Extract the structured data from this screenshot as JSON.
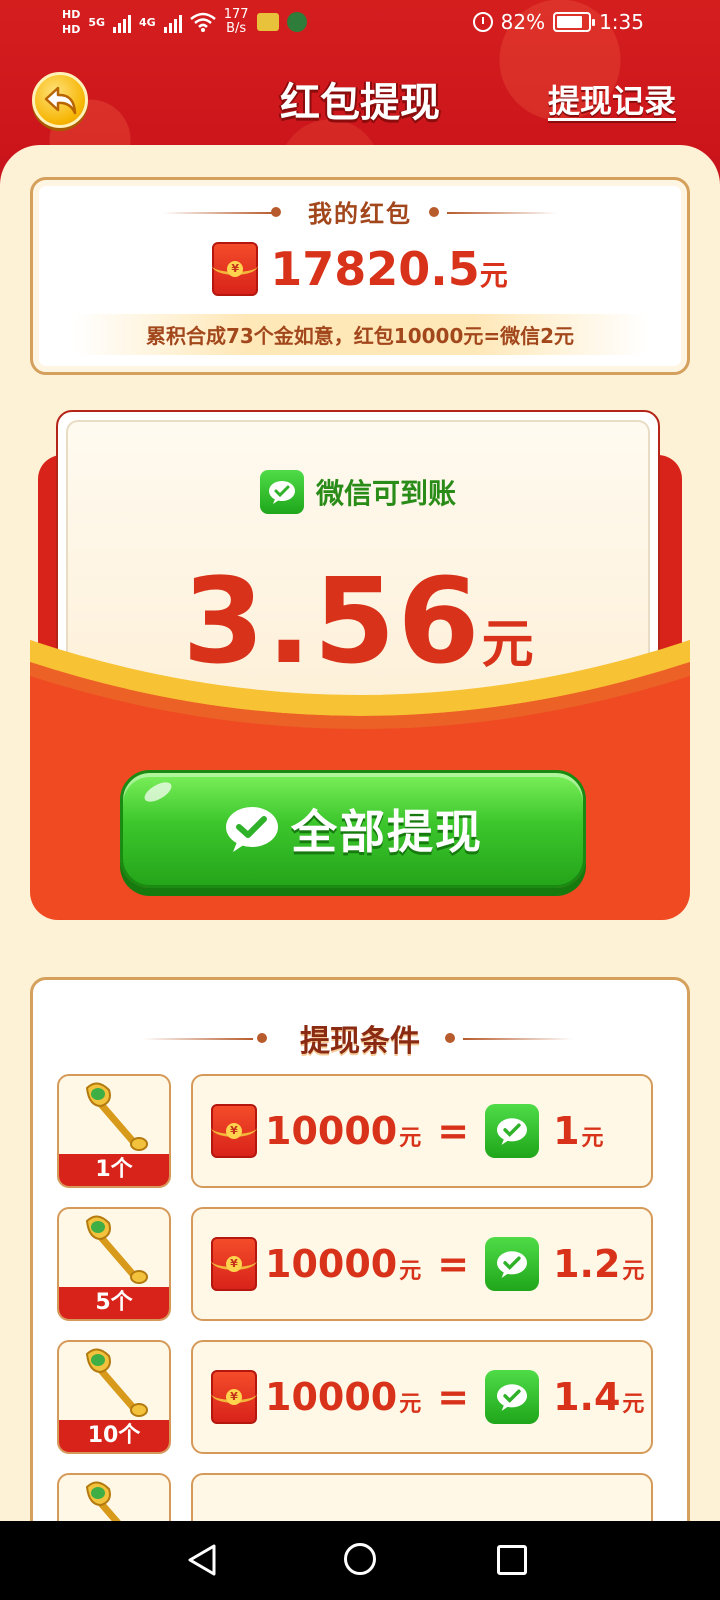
{
  "status_bar": {
    "hd_top": "HD",
    "hd_bottom": "HD",
    "network_top": "5G",
    "network_mid": "4G",
    "speed_value": "177",
    "speed_unit": "B/s",
    "battery": "82%",
    "battery_level": 0.82,
    "time": "1:35"
  },
  "header": {
    "title": "红包提现",
    "records_link": "提现记录",
    "back_icon": "back-arrow-icon"
  },
  "balance": {
    "label": "我的红包",
    "amount": "17820.5",
    "unit": "元",
    "note": "累积合成73个金如意，红包10000元=微信2元"
  },
  "envelope": {
    "wechat_label": "微信可到账",
    "amount": "3.56",
    "unit": "元",
    "button_label": "全部提现"
  },
  "conditions": {
    "title": "提现条件",
    "items": [
      {
        "count": "1个",
        "hongbao": "10000",
        "hongbao_unit": "元",
        "equals": "=",
        "wechat": "1",
        "wechat_unit": "元"
      },
      {
        "count": "5个",
        "hongbao": "10000",
        "hongbao_unit": "元",
        "equals": "=",
        "wechat": "1.2",
        "wechat_unit": "元"
      },
      {
        "count": "10个",
        "hongbao": "10000",
        "hongbao_unit": "元",
        "equals": "=",
        "wechat": "1.4",
        "wechat_unit": "元"
      }
    ]
  },
  "colors": {
    "header_red": "#c8121a",
    "panel_cream": "#fdf1d6",
    "amount_red": "#d8321a",
    "wechat_green": "#2a8c18",
    "button_green": "#3cc62c"
  }
}
